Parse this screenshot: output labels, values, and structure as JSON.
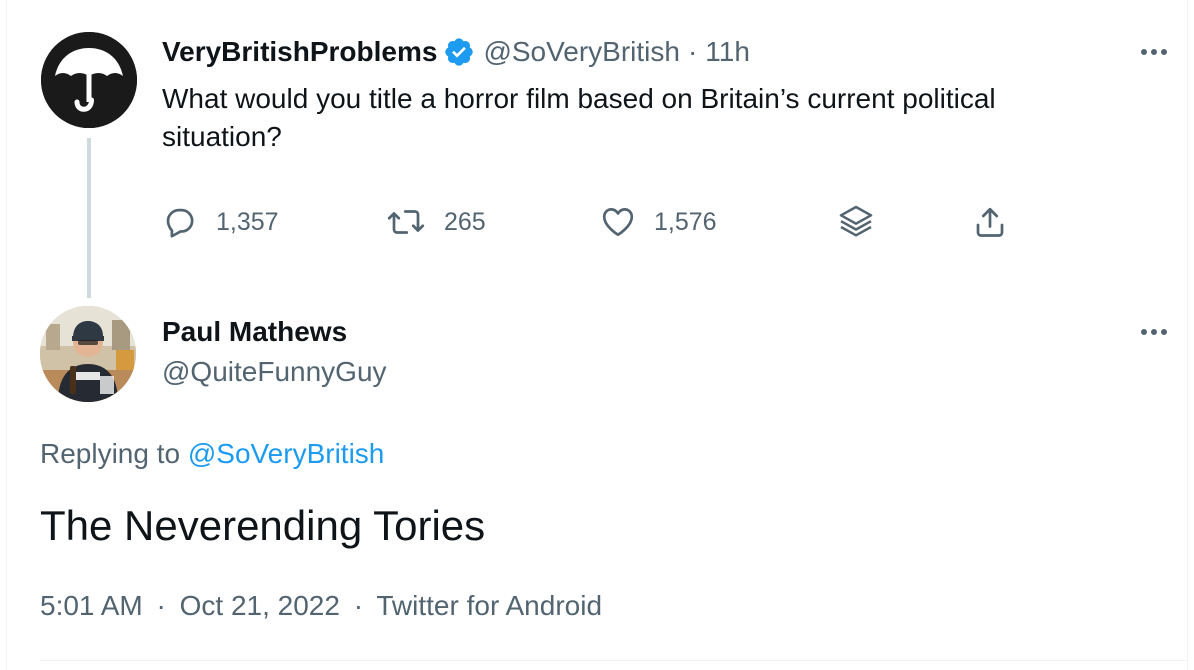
{
  "parent_tweet": {
    "author_name": "VeryBritishProblems",
    "verified": true,
    "handle": "@SoVeryBritish",
    "separator": "·",
    "time_ago": "11h",
    "text": "What would you title a horror film based on Britain’s current political situation?",
    "avatar_icon": "umbrella-icon",
    "actions": {
      "reply_count": "1,357",
      "retweet_count": "265",
      "like_count": "1,576"
    }
  },
  "reply_tweet": {
    "author_name": "Paul Mathews",
    "handle": "@QuiteFunnyGuy",
    "replying_prefix": "Replying to",
    "replying_to": "@SoVeryBritish",
    "text": "The Neverending Tories",
    "time": "5:01 AM",
    "separator": "·",
    "date": "Oct 21, 2022",
    "source": "Twitter for Android"
  },
  "colors": {
    "text_primary": "#0f1419",
    "text_secondary": "#536471",
    "link": "#1d9bf0",
    "verified_badge": "#1d9bf0",
    "thread_line": "#cfd9de"
  }
}
